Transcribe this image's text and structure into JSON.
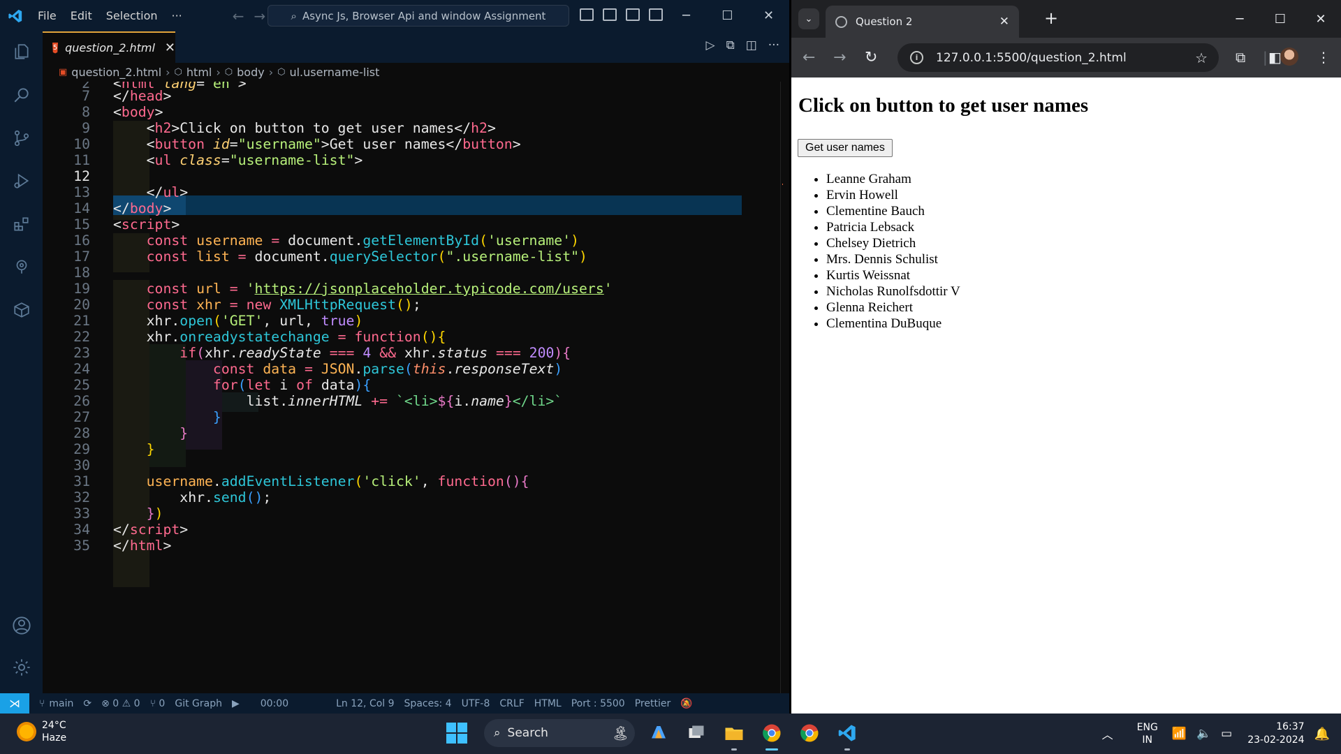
{
  "vscode": {
    "menu": [
      "File",
      "Edit",
      "Selection",
      "···"
    ],
    "search_text": "Async Js, Browser Api and window Assignment",
    "tab_label": "question_2.html",
    "breadcrumb": [
      "question_2.html",
      "html",
      "body",
      "ul.username-list"
    ],
    "status": {
      "branch": "main",
      "problems": "⊗ 0 ⚠ 0",
      "ports": "⑂ 0",
      "git_graph": "Git Graph",
      "timer": "00:00",
      "position": "Ln 12, Col 9",
      "spaces": "Spaces: 4",
      "encoding": "UTF-8",
      "eol": "CRLF",
      "language": "HTML",
      "port": "Port : 5500",
      "prettier": "Prettier"
    },
    "line_numbers": [
      "2",
      "7",
      "8",
      "9",
      "10",
      "11",
      "12",
      "13",
      "14",
      "15",
      "16",
      "17",
      "18",
      "19",
      "20",
      "21",
      "22",
      "23",
      "24",
      "25",
      "26",
      "27",
      "28",
      "29",
      "30",
      "31",
      "32",
      "33",
      "34",
      "35"
    ]
  },
  "chrome": {
    "tab_title": "Question 2",
    "url": "127.0.0.1:5500/question_2.html",
    "heading": "Click on button to get user names",
    "button_label": "Get user names",
    "users": [
      "Leanne Graham",
      "Ervin Howell",
      "Clementine Bauch",
      "Patricia Lebsack",
      "Chelsey Dietrich",
      "Mrs. Dennis Schulist",
      "Kurtis Weissnat",
      "Nicholas Runolfsdottir V",
      "Glenna Reichert",
      "Clementina DuBuque"
    ]
  },
  "taskbar": {
    "weather_temp": "24°C",
    "weather_desc": "Haze",
    "search_label": "Search",
    "lang_1": "ENG",
    "lang_2": "IN",
    "time": "16:37",
    "date": "23-02-2024"
  },
  "colors": {
    "vscode_chrome": "#0b1b2e",
    "editor_bg": "#0c0c0c",
    "tab_accent": "#e2a33a",
    "remote_button": "#1aa1e6",
    "chrome_dark": "#202124",
    "chrome_toolbar": "#35363a"
  }
}
